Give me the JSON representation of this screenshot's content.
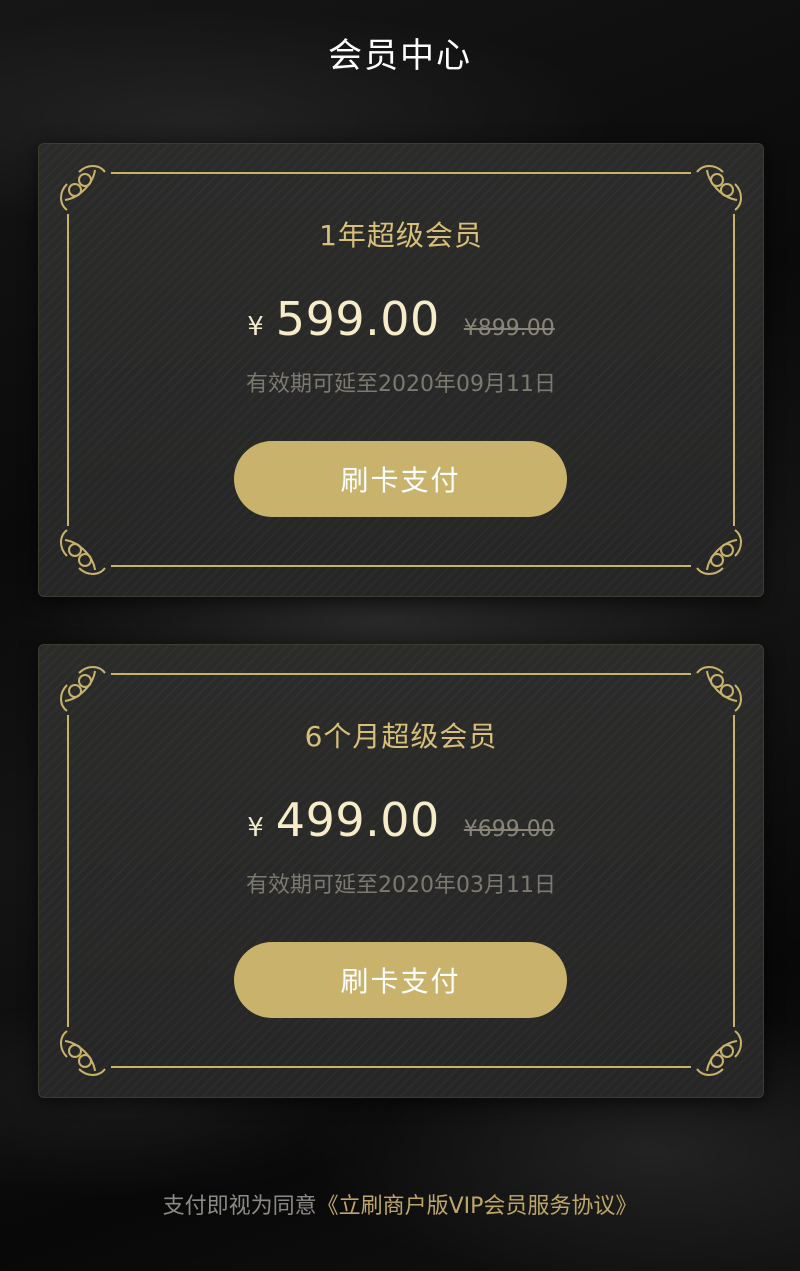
{
  "header": {
    "title": "会员中心"
  },
  "plans": [
    {
      "name": "1年超级会员",
      "currency": "¥",
      "price": "599.00",
      "original_price": "¥899.00",
      "validity": "有效期可延至2020年09月11日",
      "button_label": "刷卡支付"
    },
    {
      "name": "6个月超级会员",
      "currency": "¥",
      "price": "499.00",
      "original_price": "¥699.00",
      "validity": "有效期可延至2020年03月11日",
      "button_label": "刷卡支付"
    }
  ],
  "footer": {
    "agreement_prefix": "支付即视为同意",
    "agreement_link": "《立刷商户版VIP会员服务协议》"
  },
  "colors": {
    "accent_gold": "#c9b36c",
    "plan_name_gold": "#d8bf7a",
    "background": "#0e0e0e"
  },
  "icons": {
    "corner": "ornamental-corner-flourish-icon"
  }
}
